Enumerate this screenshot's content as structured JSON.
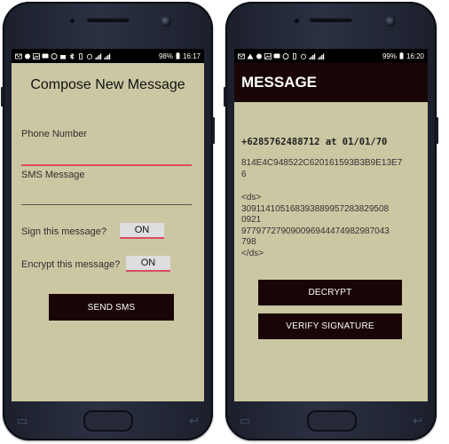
{
  "left_phone": {
    "status": {
      "battery": "98%",
      "time": "16:17"
    },
    "compose": {
      "title": "Compose New Message",
      "phone_label": "Phone Number",
      "sms_label": "SMS Message",
      "sign_label": "Sign this message?",
      "sign_value": "ON",
      "encrypt_label": "Encrypt this message?",
      "encrypt_value": "ON",
      "send_button": "SEND SMS"
    }
  },
  "right_phone": {
    "status": {
      "battery": "99%",
      "time": "16:20"
    },
    "message": {
      "title": "MESSAGE",
      "sender": "+6285762488712 at 01/01/70",
      "hash_lines": [
        "814E4C948522C620161593B3B9E13E7",
        "6"
      ],
      "ds_open": "<ds>",
      "ds_lines": [
        "309114105168393889957283829508",
        "0921",
        "977977279090096944474982987043",
        "798"
      ],
      "ds_close": "</ds>",
      "decrypt_button": "DECRYPT",
      "verify_button": "VERIFY SIGNATURE"
    }
  },
  "colors": {
    "screen_bg": "#cbc7a3",
    "dark_button": "#1a0506",
    "accent": "#d94b64",
    "phone_body": "#2c3142"
  }
}
